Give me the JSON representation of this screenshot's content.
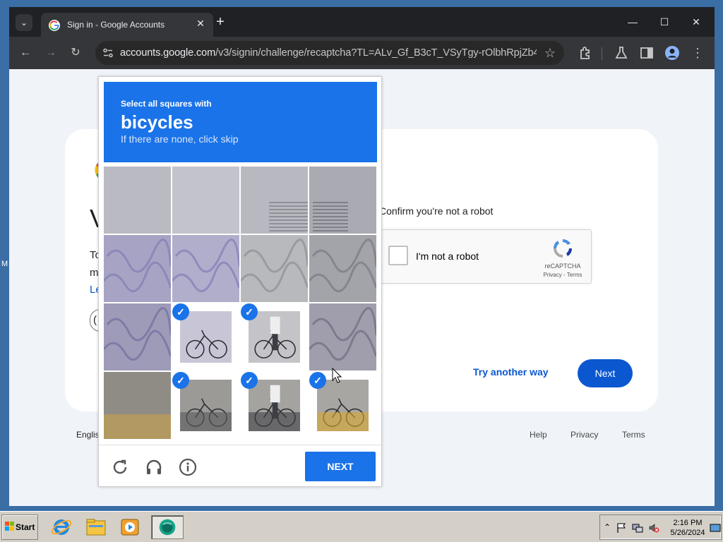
{
  "browser": {
    "tab_title": "Sign in - Google Accounts",
    "tab_close": "✕",
    "new_tab": "+",
    "tab_menu": "⌄",
    "minimize": "—",
    "maximize": "☐",
    "close": "✕",
    "back": "←",
    "forward": "→",
    "reload": "↻",
    "url_host": "accounts.google.com",
    "url_path": "/v3/signin/challenge/recaptcha?TL=ALv_Gf_B3cT_VSyTgy-rOlbhRpjZb4A...",
    "bookmark_star": "☆"
  },
  "page": {
    "headline_fragment": "V",
    "body_fragment_1": "To",
    "body_fragment_2": "m",
    "link_fragment": "Le",
    "chip_fragment": "(",
    "confirm_text": "Confirm you're not a robot",
    "recaptcha": {
      "label": "I'm not a robot",
      "brand": "reCAPTCHA",
      "terms": "Privacy - Terms"
    },
    "try_another_way": "Try another way",
    "next": "Next",
    "footer": {
      "language": "Englis",
      "help": "Help",
      "privacy": "Privacy",
      "terms": "Terms"
    },
    "edge_fragment": "M"
  },
  "challenge": {
    "prompt": "Select all squares with",
    "object": "bicycles",
    "skip_hint": "If there are none, click skip",
    "next_button": "NEXT",
    "check_glyph": "✓",
    "tiles": [
      {
        "selected": false
      },
      {
        "selected": false
      },
      {
        "selected": false
      },
      {
        "selected": false
      },
      {
        "selected": false
      },
      {
        "selected": false
      },
      {
        "selected": false
      },
      {
        "selected": false
      },
      {
        "selected": false
      },
      {
        "selected": true
      },
      {
        "selected": true
      },
      {
        "selected": false
      },
      {
        "selected": false
      },
      {
        "selected": true
      },
      {
        "selected": true
      },
      {
        "selected": true
      }
    ]
  },
  "taskbar": {
    "start_label": "Start",
    "clock_time": "2:16 PM",
    "clock_date": "5/26/2024",
    "tray_chevron": "⌃"
  },
  "colors": {
    "accent": "#1a73e8",
    "google_blue": "#0b57d0",
    "desktop": "#3a6ea5"
  }
}
